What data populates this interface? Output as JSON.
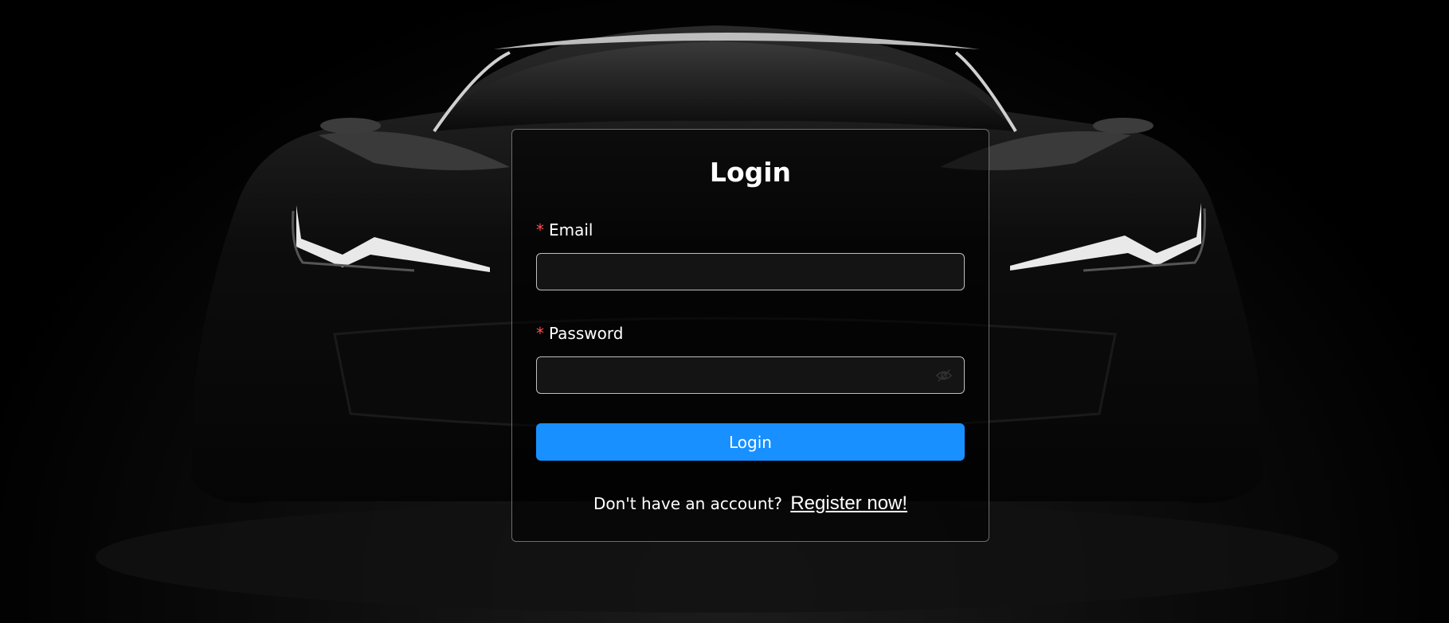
{
  "login": {
    "title": "Login",
    "email_label": "Email",
    "email_value": "",
    "password_label": "Password",
    "password_value": "",
    "required_mark": "*",
    "submit_label": "Login",
    "register_prompt": "Don't have an account?",
    "register_link": "Register now!"
  },
  "icons": {
    "password_toggle": "eye-invisible-icon"
  },
  "colors": {
    "primary": "#1890ff",
    "required": "#ff4d4f",
    "background": "#000000"
  }
}
